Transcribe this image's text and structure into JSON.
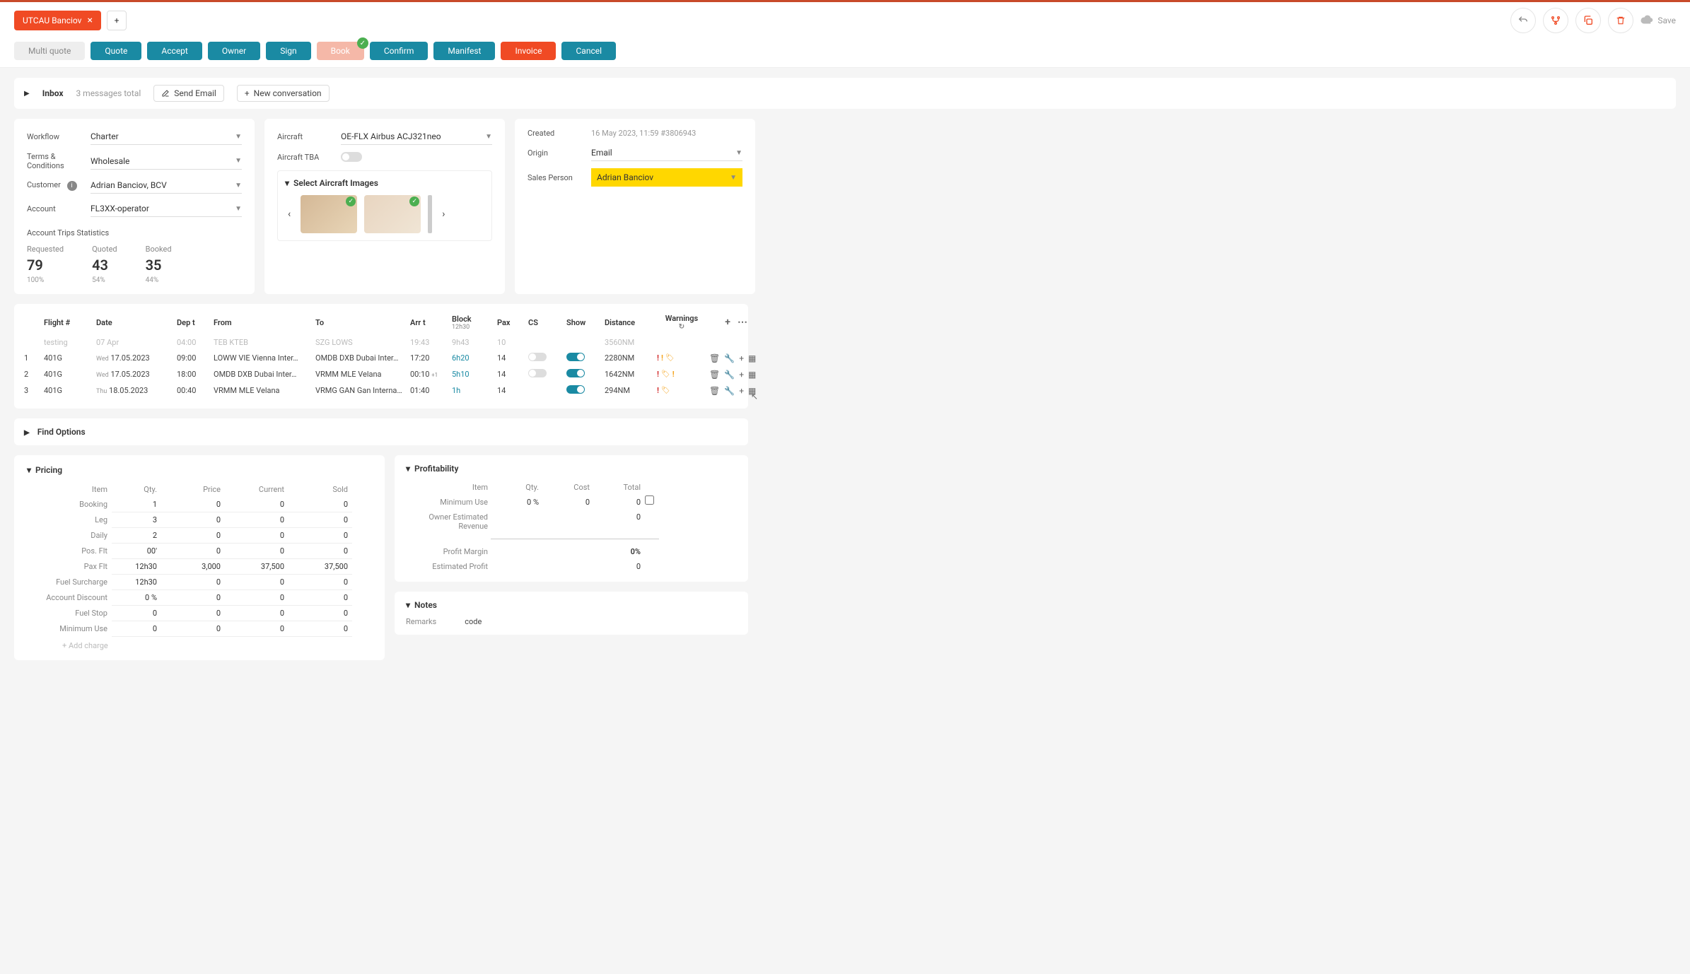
{
  "tab": {
    "label": "UTCAU Banciov"
  },
  "topActions": {
    "save": "Save"
  },
  "actions": {
    "multiQuote": "Multi quote",
    "quote": "Quote",
    "accept": "Accept",
    "owner": "Owner",
    "sign": "Sign",
    "book": "Book",
    "confirm": "Confirm",
    "manifest": "Manifest",
    "invoice": "Invoice",
    "cancel": "Cancel"
  },
  "inbox": {
    "title": "Inbox",
    "count": "3 messages total",
    "sendEmail": "Send Email",
    "newConv": "New conversation"
  },
  "left": {
    "workflow": {
      "label": "Workflow",
      "value": "Charter"
    },
    "terms": {
      "label": "Terms & Conditions",
      "value": "Wholesale"
    },
    "customer": {
      "label": "Customer",
      "value": "Adrian Banciov, BCV"
    },
    "account": {
      "label": "Account",
      "value": "FL3XX-operator"
    },
    "statsTitle": "Account Trips Statistics",
    "stats": {
      "requested": {
        "label": "Requested",
        "value": "79",
        "pct": "100%"
      },
      "quoted": {
        "label": "Quoted",
        "value": "43",
        "pct": "54%"
      },
      "booked": {
        "label": "Booked",
        "value": "35",
        "pct": "44%"
      }
    }
  },
  "mid": {
    "aircraft": {
      "label": "Aircraft",
      "value": "OE-FLX Airbus ACJ321neo"
    },
    "tba": {
      "label": "Aircraft TBA"
    },
    "imgSection": "Select Aircraft Images"
  },
  "right": {
    "created": {
      "label": "Created",
      "value": "16 May 2023, 11:59  #3806943"
    },
    "origin": {
      "label": "Origin",
      "value": "Email"
    },
    "sales": {
      "label": "Sales Person",
      "value": "Adrian Banciov"
    }
  },
  "ftHead": {
    "flight": "Flight #",
    "date": "Date",
    "dept": "Dep t",
    "from": "From",
    "to": "To",
    "arrt": "Arr t",
    "block": "Block",
    "blockSub": "12h30",
    "pax": "Pax",
    "cs": "CS",
    "show": "Show",
    "distance": "Distance",
    "warnings": "Warnings"
  },
  "ftRows": {
    "faded": {
      "flight": "testing",
      "date": "07 Apr",
      "dept": "04:00",
      "from": "TEB KTEB",
      "to": "SZG LOWS",
      "arrt": "19:43",
      "block": "9h43",
      "pax": "10",
      "dist": "3560NM"
    },
    "r1": {
      "num": "1",
      "flight": "401G",
      "day": "Wed",
      "date": "17.05.2023",
      "dept": "09:00",
      "from": "LOWW VIE Vienna Inter…",
      "to": "OMDB DXB Dubai Inter…",
      "arrt": "17:20",
      "block": "6h20",
      "pax": "14",
      "dist": "2280NM"
    },
    "r2": {
      "num": "2",
      "flight": "401G",
      "day": "Wed",
      "date": "17.05.2023",
      "dept": "18:00",
      "from": "OMDB DXB Dubai Inter…",
      "to": "VRMM MLE Velana",
      "arrt": "00:10",
      "arrtPlus": "+1",
      "block": "5h10",
      "pax": "14",
      "dist": "1642NM"
    },
    "r3": {
      "num": "3",
      "flight": "401G",
      "day": "Thu",
      "date": "18.05.2023",
      "dept": "00:40",
      "from": "VRMM MLE Velana",
      "to": "VRMG GAN Gan Interna…",
      "arrt": "01:40",
      "block": "1h",
      "pax": "14",
      "dist": "294NM"
    }
  },
  "findOptions": "Find Options",
  "pricing": {
    "title": "Pricing",
    "headers": {
      "item": "Item",
      "qty": "Qty.",
      "price": "Price",
      "current": "Current",
      "sold": "Sold"
    },
    "rows": {
      "booking": {
        "label": "Booking",
        "qty": "1",
        "price": "0",
        "current": "0",
        "sold": "0"
      },
      "leg": {
        "label": "Leg",
        "qty": "3",
        "price": "0",
        "current": "0",
        "sold": "0"
      },
      "daily": {
        "label": "Daily",
        "qty": "2",
        "price": "0",
        "current": "0",
        "sold": "0"
      },
      "posflt": {
        "label": "Pos. Flt",
        "qty": "00'",
        "price": "0",
        "current": "0",
        "sold": "0"
      },
      "paxflt": {
        "label": "Pax Flt",
        "qty": "12h30",
        "price": "3,000",
        "current": "37,500",
        "sold": "37,500"
      },
      "fuel": {
        "label": "Fuel Surcharge",
        "qty": "12h30",
        "price": "0",
        "current": "0",
        "sold": "0"
      },
      "disc": {
        "label": "Account Discount",
        "qty": "0 %",
        "price": "0",
        "current": "0",
        "sold": "0"
      },
      "stop": {
        "label": "Fuel Stop",
        "qty": "0",
        "price": "0",
        "current": "0",
        "sold": "0"
      },
      "minuse": {
        "label": "Minimum Use",
        "qty": "0",
        "price": "0",
        "current": "0",
        "sold": "0"
      }
    },
    "addCharge": "+ Add charge"
  },
  "profit": {
    "title": "Profitability",
    "headers": {
      "item": "Item",
      "qty": "Qty.",
      "cost": "Cost",
      "total": "Total"
    },
    "minUse": {
      "label": "Minimum Use",
      "qty": "0 %",
      "cost": "0",
      "total": "0"
    },
    "owner": {
      "label": "Owner Estimated Revenue",
      "total": "0"
    },
    "margin": {
      "label": "Profit Margin",
      "total": "0%"
    },
    "est": {
      "label": "Estimated Profit",
      "total": "0"
    }
  },
  "notes": {
    "title": "Notes",
    "remarksLabel": "Remarks",
    "remarksValue": "code"
  }
}
